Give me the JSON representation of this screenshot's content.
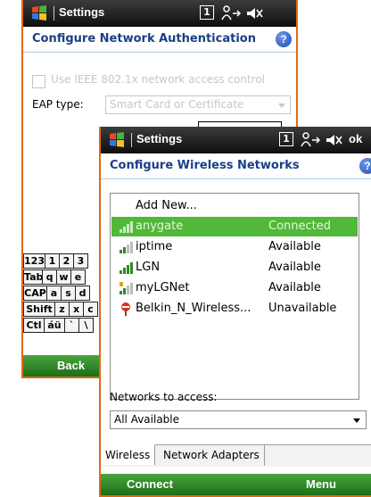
{
  "back_window": {
    "app_title": "Settings",
    "header_title": "Configure Network Authentication",
    "ieee_checkbox_label": "Use IEEE 802.1x network access control",
    "eap_label": "EAP type:",
    "eap_value": "Smart Card or Certificate",
    "keyboard": {
      "row1": [
        "123",
        "1",
        "2",
        "3"
      ],
      "row2": [
        "Tab",
        "q",
        "w",
        "e"
      ],
      "row3": [
        "CAP",
        "a",
        "s",
        "d"
      ],
      "row4": [
        "Shift",
        "z",
        "x",
        "c"
      ],
      "row5": [
        "Ctl",
        "áü",
        "`",
        "\\"
      ]
    },
    "menu": {
      "left": "Back"
    }
  },
  "front_window": {
    "app_title": "Settings",
    "ok_label": "ok",
    "header_title": "Configure Wireless Networks",
    "add_new_label": "Add New...",
    "networks": [
      {
        "name": "anygate",
        "status": "Connected",
        "selected": true,
        "icon": "wifi-signal-icon"
      },
      {
        "name": "iptime",
        "status": "Available",
        "selected": false,
        "icon": "wifi-signal-icon"
      },
      {
        "name": "LGN",
        "status": "Available",
        "selected": false,
        "icon": "wifi-signal-icon"
      },
      {
        "name": "myLGNet",
        "status": "Available",
        "selected": false,
        "icon": "wifi-secure-signal-icon"
      },
      {
        "name": "Belkin_N_Wireless...",
        "status": "Unavailable",
        "selected": false,
        "icon": "unavailable-network-icon"
      }
    ],
    "networks_to_access_label": "Networks to access:",
    "networks_to_access_value": "All Available",
    "tabs": [
      "Wireless",
      "Network Adapters"
    ],
    "menu": {
      "left": "Connect",
      "right": "Menu"
    }
  },
  "status_icons": [
    "keypad-1-icon",
    "connectivity-icon",
    "volume-muted-icon"
  ],
  "colors": {
    "title_bar": "#1a1a1a",
    "header_text": "#1b3f86",
    "accent_orange": "#e06a12",
    "softkey_green": "#2f8a27",
    "selection_green": "#52b83a"
  }
}
